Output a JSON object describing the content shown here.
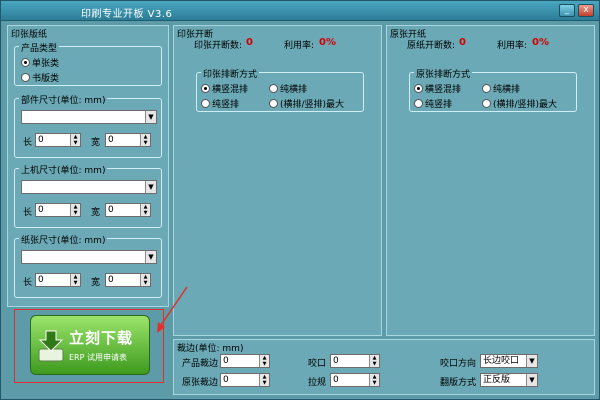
{
  "window": {
    "title": "印刷专业开板 V3.6",
    "min_glyph": "_",
    "close_glyph": "x"
  },
  "left": {
    "group_title": "印张版纸",
    "product_type": {
      "title": "产品类型",
      "options": [
        "单张类",
        "书版类"
      ],
      "selected": 0
    },
    "part_size": {
      "title": "部件尺寸(单位: mm)",
      "combo_value": "",
      "length_label": "长",
      "length": "0",
      "width_label": "宽",
      "width": "0"
    },
    "machine_size": {
      "title": "上机尺寸(单位: mm)",
      "combo_value": "",
      "length_label": "长",
      "length": "0",
      "width_label": "宽",
      "width": "0"
    },
    "paper_size": {
      "title": "纸张尺寸(单位: mm)",
      "combo_value": "",
      "length_label": "长",
      "length": "0",
      "width_label": "宽",
      "width": "0"
    },
    "download": {
      "main": "立刻下载",
      "sub": "ERP 试用申请表"
    }
  },
  "print_sheet": {
    "title": "印张开断",
    "count_label": "印张开断数:",
    "count": "0",
    "rate_label": "利用率:",
    "rate": "0%",
    "method": {
      "title": "印张排断方式",
      "options": [
        "横竖混排",
        "纯横排",
        "纯竖排",
        "(横排/竖排)最大"
      ],
      "selected": 0
    }
  },
  "raw_paper": {
    "title": "原张开纸",
    "count_label": "原纸开断数:",
    "count": "0",
    "rate_label": "利用率:",
    "rate": "0%",
    "method": {
      "title": "原张排断方式",
      "options": [
        "横竖混排",
        "纯横排",
        "纯竖排",
        "(横排/竖排)最大"
      ],
      "selected": 0
    }
  },
  "trim": {
    "title": "裁边(单位: mm)",
    "product_trim_label": "产品裁边",
    "product_trim": "0",
    "raw_trim_label": "原张裁边",
    "raw_trim": "0",
    "bite_label": "咬口",
    "bite": "0",
    "pull_label": "拉规",
    "pull": "0",
    "bite_dir_label": "咬口方向",
    "bite_dir": "长边咬口",
    "flip_label": "翻版方式",
    "flip": "正反版"
  },
  "colors": {
    "panel": "#6aa9b5",
    "value_red": "#d40000",
    "download_green": "#3e9a1f",
    "highlight_red": "#e0302a"
  }
}
